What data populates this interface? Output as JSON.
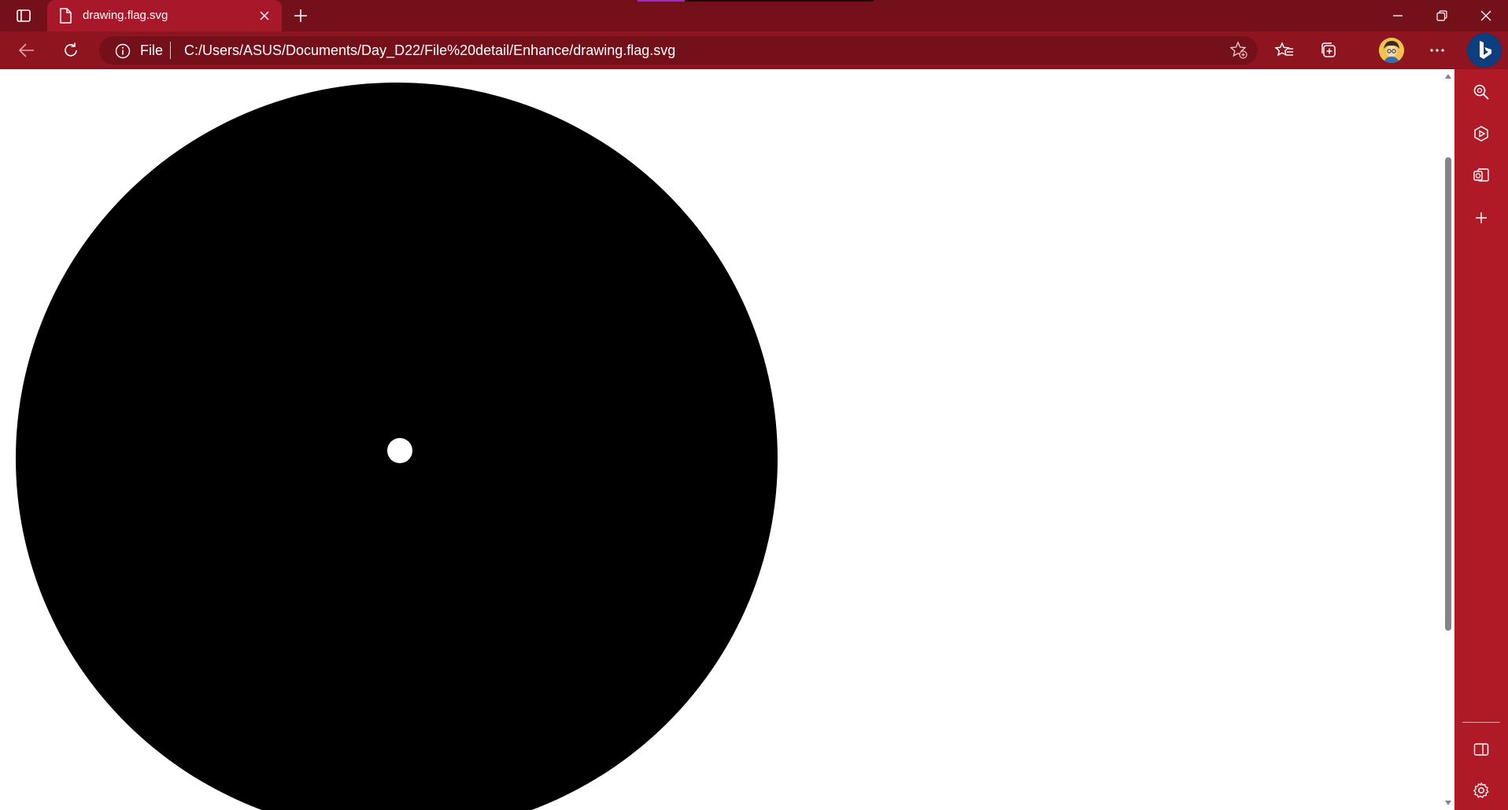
{
  "browser": {
    "tab": {
      "title": "drawing.flag.svg"
    },
    "address": {
      "scheme": "File",
      "url": "C:/Users/ASUS/Documents/Day_D22/File%20detail/Enhance/drawing.flag.svg"
    },
    "colors": {
      "titlebar": "#74101a",
      "toolbar": "#8e1420",
      "sidepanel": "#b01a27"
    },
    "sidebar_icons": [
      "search-icon",
      "copilot-icon",
      "outlook-icon",
      "add-icon",
      "split-screen-icon",
      "settings-icon"
    ]
  },
  "drawing": {
    "disc_color": "#000000",
    "dot_color": "#ffffff"
  }
}
